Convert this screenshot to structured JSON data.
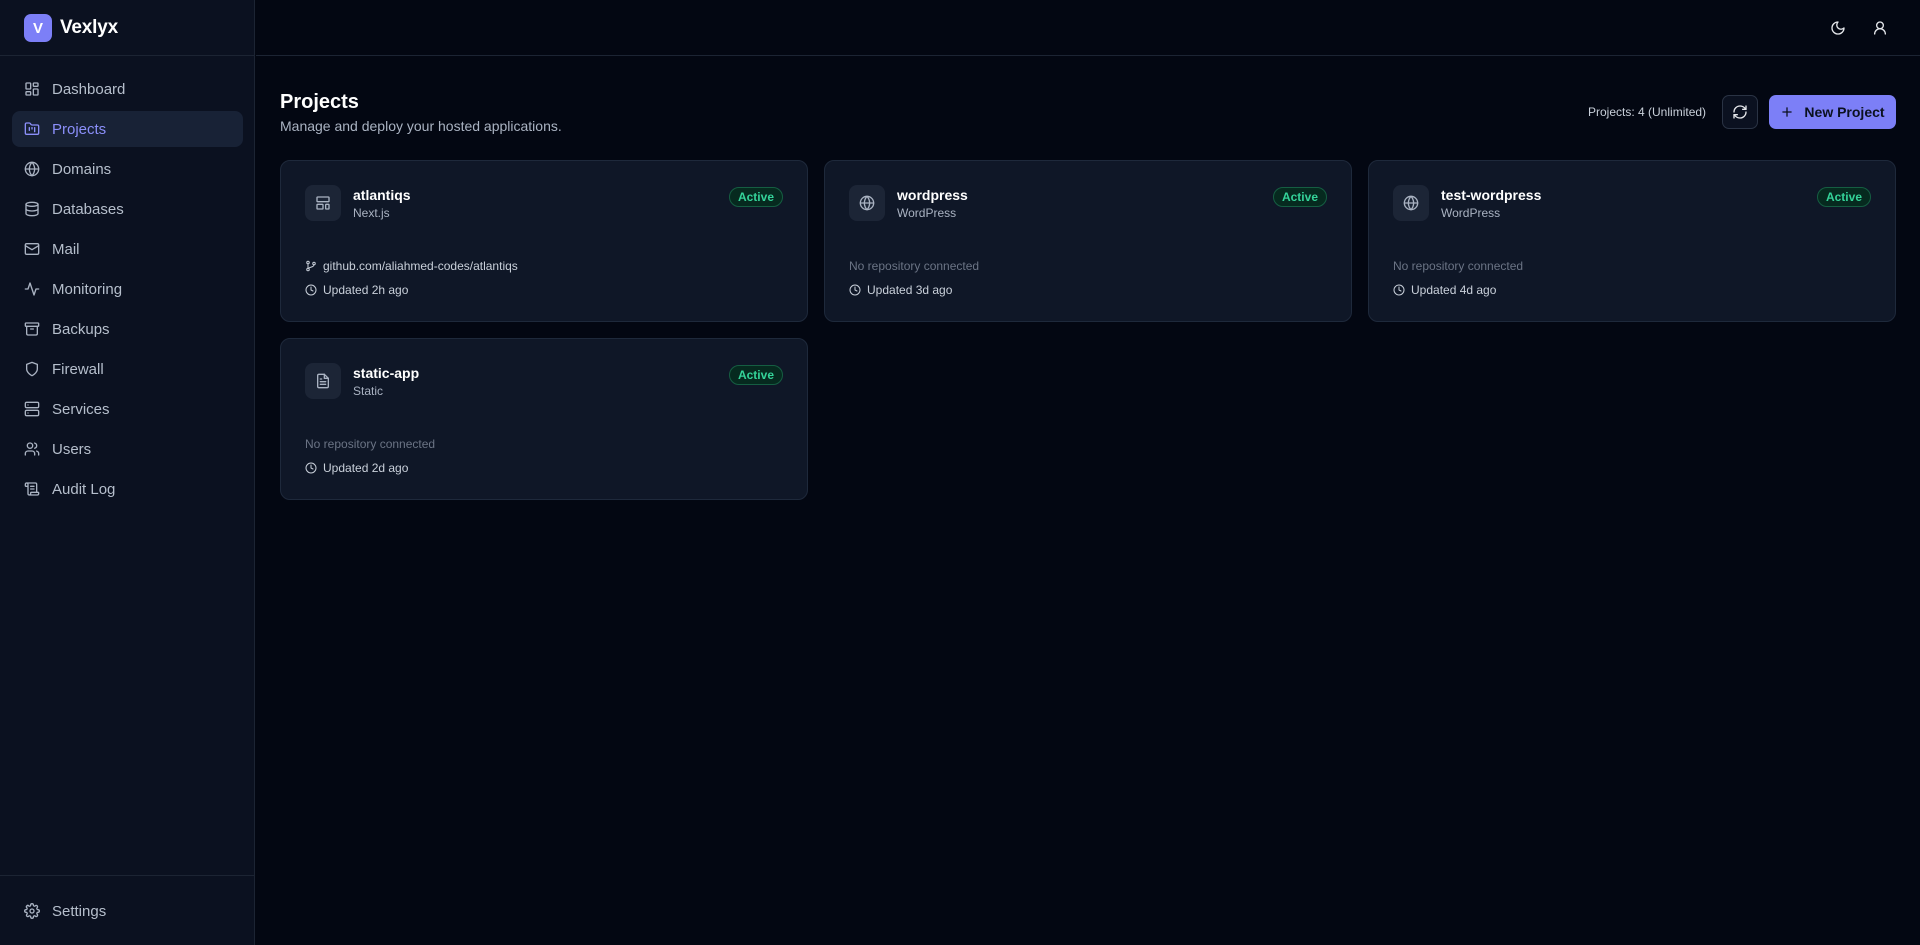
{
  "brand": {
    "logo_letter": "V",
    "name": "Vexlyx",
    "accent": "#7c7ff7"
  },
  "sidebar": {
    "items": [
      {
        "label": "Dashboard",
        "icon": "grid-icon",
        "active": false
      },
      {
        "label": "Projects",
        "icon": "folder-icon",
        "active": true
      },
      {
        "label": "Domains",
        "icon": "globe-icon",
        "active": false
      },
      {
        "label": "Databases",
        "icon": "database-icon",
        "active": false
      },
      {
        "label": "Mail",
        "icon": "mail-icon",
        "active": false
      },
      {
        "label": "Monitoring",
        "icon": "activity-icon",
        "active": false
      },
      {
        "label": "Backups",
        "icon": "archive-icon",
        "active": false
      },
      {
        "label": "Firewall",
        "icon": "shield-icon",
        "active": false
      },
      {
        "label": "Services",
        "icon": "server-icon",
        "active": false
      },
      {
        "label": "Users",
        "icon": "users-icon",
        "active": false
      },
      {
        "label": "Audit Log",
        "icon": "scroll-icon",
        "active": false
      }
    ],
    "settings_label": "Settings"
  },
  "header": {
    "title": "Projects",
    "subtitle": "Manage and deploy your hosted applications.",
    "quota": "Projects: 4 (Unlimited)",
    "new_project_label": "New Project"
  },
  "projects": [
    {
      "name": "atlantiqs",
      "type": "Next.js",
      "status": "Active",
      "repo": "github.com/aliahmed-codes/atlantiqs",
      "repo_connected": true,
      "updated": "Updated 2h ago",
      "icon": "layout-icon"
    },
    {
      "name": "wordpress",
      "type": "WordPress",
      "status": "Active",
      "repo": "No repository connected",
      "repo_connected": false,
      "updated": "Updated 3d ago",
      "icon": "globe-icon"
    },
    {
      "name": "test-wordpress",
      "type": "WordPress",
      "status": "Active",
      "repo": "No repository connected",
      "repo_connected": false,
      "updated": "Updated 4d ago",
      "icon": "globe-icon"
    },
    {
      "name": "static-app",
      "type": "Static",
      "status": "Active",
      "repo": "No repository connected",
      "repo_connected": false,
      "updated": "Updated 2d ago",
      "icon": "file-icon"
    }
  ],
  "colors": {
    "status_active": "#34d399",
    "background": "#030712",
    "card": "#0f1727"
  }
}
